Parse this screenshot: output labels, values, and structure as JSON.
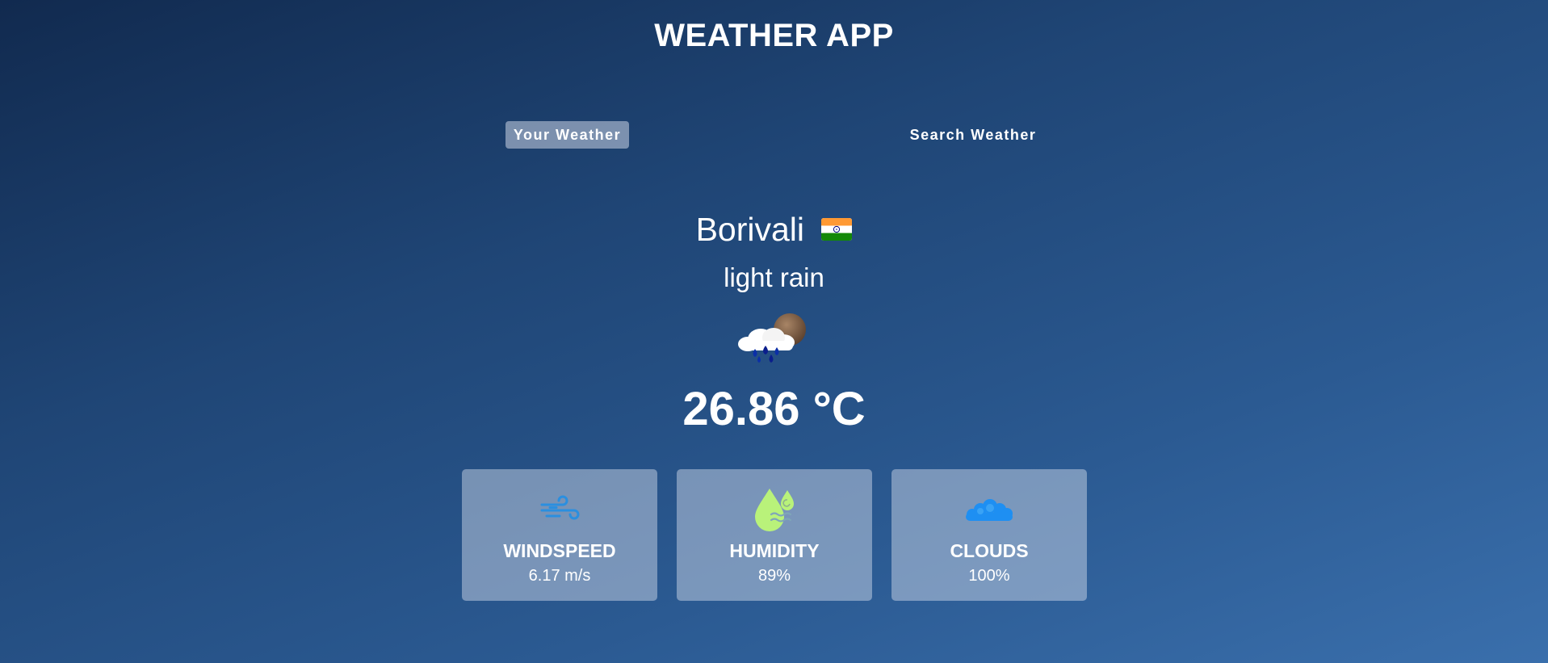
{
  "app": {
    "title": "WEATHER APP"
  },
  "tabs": [
    {
      "label": "Your Weather",
      "active": true
    },
    {
      "label": "Search Weather",
      "active": false
    }
  ],
  "location": {
    "city": "Borivali",
    "country_flag": "flag-india-icon"
  },
  "weather": {
    "description": "light rain",
    "icon": "rain-cloud-with-moon-icon",
    "temperature": "26.86 °C"
  },
  "stats": {
    "windspeed": {
      "label": "WINDSPEED",
      "value": "6.17 m/s",
      "icon": "wind-icon"
    },
    "humidity": {
      "label": "HUMIDITY",
      "value": "89%",
      "icon": "humidity-icon"
    },
    "clouds": {
      "label": "CLOUDS",
      "value": "100%",
      "icon": "cloud-icon"
    }
  },
  "colors": {
    "background_top": "#112a4f",
    "background_bottom": "#3a6fac",
    "wind_icon": "#2a8fe0",
    "humidity_icon": "#b9f27a",
    "cloud_icon": "#1e8ff2"
  }
}
